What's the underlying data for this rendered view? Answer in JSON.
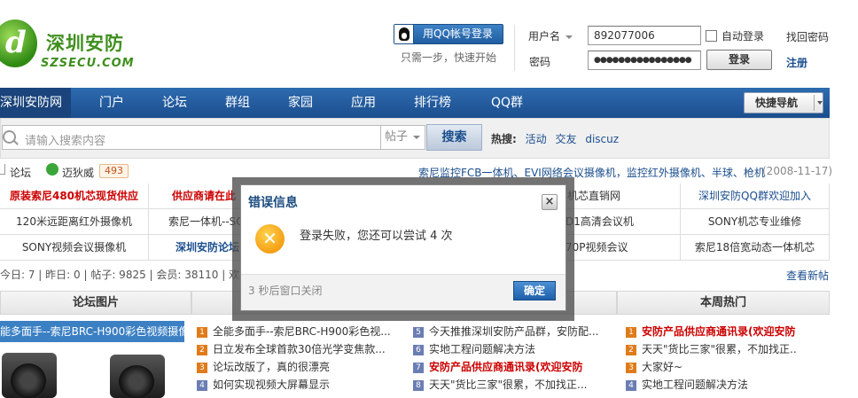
{
  "header": {
    "logo_text_cn": "深圳安防",
    "logo_text_en": "SZSECU.COM",
    "logo_glyph": "d",
    "qq_login_label": "用QQ帐号登录",
    "qq_login_tip": "只需一步，快速开始",
    "username_label": "用户名",
    "username_value": "892077006",
    "password_label": "密码",
    "password_value": "●●●●●●●●●●●●●●●●",
    "auto_login_label": "自动登录",
    "login_button": "登录",
    "find_password": "找回密码",
    "register": "注册"
  },
  "nav": {
    "items": [
      "深圳安防网",
      "门户",
      "论坛",
      "群组",
      "家园",
      "应用",
      "排行榜",
      "QQ群"
    ],
    "quick_nav": "快捷导航"
  },
  "search": {
    "placeholder": "请输入搜索内容",
    "scope": "帖子",
    "button": "搜索",
    "hot_label": "热搜:",
    "hot_terms": [
      "活动",
      "交友",
      "discuz"
    ]
  },
  "breadcrumb": {
    "forum": "论坛",
    "user": "迈狄威",
    "badge": "493",
    "news": "索尼监控FCB一体机、EVI网络会议摄像机，监控红外摄像机、半球、枪机",
    "news_date": "(2008-11-17)"
  },
  "link_grid": [
    [
      "原装索尼480机芯现货供应",
      "供应商请在此",
      "",
      "机芯直销网",
      "深圳安防QQ群欢迎加入"
    ],
    [
      "120米远距离红外摄像机",
      "索尼一体机--SO",
      "",
      "D1高清会议机",
      "SONY机芯专业维修"
    ],
    [
      "SONY视频会议摄像机",
      "深圳安防论坛",
      "",
      "70P视频会议",
      "索尼18倍宽动态一体机芯"
    ]
  ],
  "stats": {
    "text": "今日: 7  |  昨日: 0  |  帖子: 9825  |  会员: 38110  |  欢"
  },
  "new_posts_link": "查看新帖",
  "columns": {
    "forum_pics_title": "论坛图片",
    "hot_week_title": "本周热门",
    "marquee": "能多面手--索尼BRC-H900彩色视频摄像"
  },
  "list_new": [
    {
      "n": "1",
      "text": "全能多面手--索尼BRC-H900彩色视..."
    },
    {
      "n": "2",
      "text": "日立发布全球首款30倍光学变焦款..."
    },
    {
      "n": "3",
      "text": "论坛改版了，真的很漂亮"
    },
    {
      "n": "4",
      "text": "如何实现视频大屏幕显示"
    }
  ],
  "list_mid": [
    {
      "n": "5",
      "text": "今天推推深圳安防产品群，安防配..."
    },
    {
      "n": "6",
      "text": "实地工程问题解决方法"
    },
    {
      "n": "7",
      "text": "安防产品供应商通讯录(欢迎安防",
      "hot": true
    },
    {
      "n": "8",
      "text": "天天\"货比三家\"很累，不加找正..."
    }
  ],
  "list_hot": [
    {
      "n": "1",
      "text": "安防产品供应商通讯录(欢迎安防",
      "hot": true
    },
    {
      "n": "2",
      "text": "天天\"货比三家\"很累，不加找正.."
    },
    {
      "n": "3",
      "text": "大家好~"
    },
    {
      "n": "4",
      "text": "实地工程问题解决方法"
    }
  ],
  "dialog": {
    "title": "错误信息",
    "close": "×",
    "icon_glyph": "✕",
    "message": "登录失败，您还可以尝试 4 次",
    "countdown": "3 秒后窗口关闭",
    "ok": "确定"
  }
}
